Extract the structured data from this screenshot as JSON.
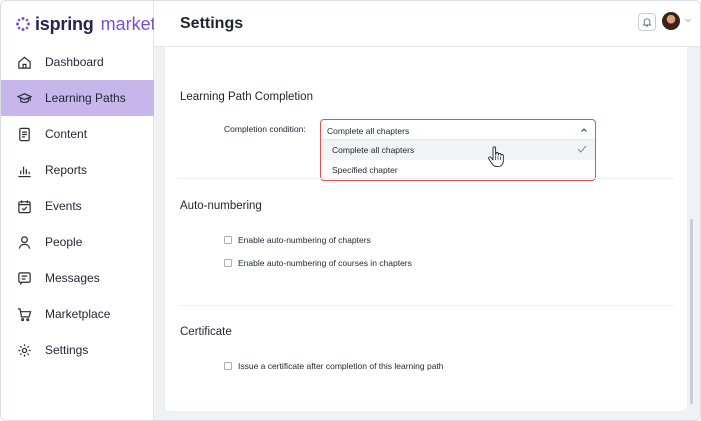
{
  "brand": {
    "name_part1": "ispring",
    "name_part2": "market",
    "accent": "#7b4fd1"
  },
  "sidebar": {
    "items": [
      {
        "label": "Dashboard",
        "icon": "home-icon",
        "active": false
      },
      {
        "label": "Learning Paths",
        "icon": "graduation-cap-icon",
        "active": true
      },
      {
        "label": "Content",
        "icon": "document-icon",
        "active": false
      },
      {
        "label": "Reports",
        "icon": "bar-chart-icon",
        "active": false
      },
      {
        "label": "Events",
        "icon": "calendar-check-icon",
        "active": false
      },
      {
        "label": "People",
        "icon": "person-icon",
        "active": false
      },
      {
        "label": "Messages",
        "icon": "message-icon",
        "active": false
      },
      {
        "label": "Marketplace",
        "icon": "cart-icon",
        "active": false
      },
      {
        "label": "Settings",
        "icon": "gear-icon",
        "active": false
      }
    ]
  },
  "header": {
    "title": "Settings"
  },
  "completion": {
    "title": "Learning Path Completion",
    "field_label": "Completion condition:",
    "selected": "Complete all chapters",
    "options": [
      "Complete all chapters",
      "Specified chapter"
    ]
  },
  "numbering": {
    "title": "Auto-numbering",
    "checkboxes": [
      "Enable auto-numbering of chapters",
      "Enable auto-numbering of courses in chapters"
    ]
  },
  "certificate": {
    "title": "Certificate",
    "checkbox": "Issue a certificate after completion of this learning path"
  },
  "colors": {
    "active_nav": "#c7b6ec",
    "error_border": "#e0524f"
  }
}
